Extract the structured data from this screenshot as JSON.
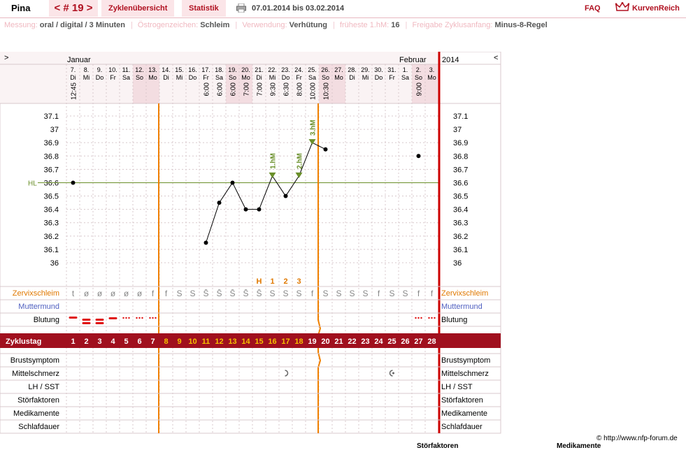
{
  "header": {
    "user": "Pina",
    "cycle_tab": "< # 19 >",
    "overview_tab": "Zyklenübersicht",
    "stats_tab": "Statistik",
    "range": "07.01.2014 bis 03.02.2014",
    "faq": "FAQ",
    "brand": "KurvenReich"
  },
  "info": {
    "measure_label": "Messung:",
    "measure_value": "oral / digital / 3 Minuten",
    "estrogen_label": "Östrogenzeichen:",
    "estrogen_value": "Schleim",
    "usage_label": "Verwendung:",
    "usage_value": "Verhütung",
    "earliest_label": "früheste 1.hM:",
    "earliest_value": "16",
    "release_label": "Freigabe Zyklusanfang:",
    "release_value": "Minus-8-Regel"
  },
  "nav": {
    "prev": ">",
    "next": "<",
    "year": "2014"
  },
  "chart_data": {
    "type": "line",
    "months": [
      {
        "label": "Januar",
        "day": 1
      },
      {
        "label": "Februar",
        "day": 26
      }
    ],
    "dates": [
      "7.",
      "8.",
      "9.",
      "10.",
      "11.",
      "12.",
      "13.",
      "14.",
      "15.",
      "16.",
      "17.",
      "18.",
      "19.",
      "20.",
      "21.",
      "22.",
      "23.",
      "24.",
      "25.",
      "26.",
      "27.",
      "28.",
      "29.",
      "30.",
      "31.",
      "1.",
      "2.",
      "3."
    ],
    "weekdays": [
      "Di",
      "Mi",
      "Do",
      "Fr",
      "Sa",
      "So",
      "Mo",
      "Di",
      "Mi",
      "Do",
      "Fr",
      "Sa",
      "So",
      "Mo",
      "Di",
      "Mi",
      "Do",
      "Fr",
      "Sa",
      "So",
      "Mo",
      "Di",
      "Mi",
      "Do",
      "Fr",
      "Sa",
      "So",
      "Mo"
    ],
    "weekend_days": [
      5,
      6,
      12,
      13,
      19,
      20,
      26,
      27
    ],
    "times": [
      "12:45",
      "",
      "",
      "",
      "",
      "",
      "",
      "",
      "",
      "",
      "6:00",
      "6:00",
      "6:00",
      "7:00",
      "7:00",
      "9:30",
      "6:30",
      "8:00",
      "10:00",
      "10:30",
      "",
      "",
      "",
      "",
      "",
      "",
      "9:00",
      ""
    ],
    "cycle_days": [
      1,
      2,
      3,
      4,
      5,
      6,
      7,
      8,
      9,
      10,
      11,
      12,
      13,
      14,
      15,
      16,
      17,
      18,
      19,
      20,
      21,
      22,
      23,
      24,
      25,
      26,
      27,
      28
    ],
    "x": [
      1,
      2,
      3,
      4,
      5,
      6,
      7,
      8,
      9,
      10,
      11,
      12,
      13,
      14,
      15,
      16,
      17,
      18,
      19,
      20,
      21,
      22,
      23,
      24,
      25,
      26,
      27,
      28
    ],
    "temperature": [
      36.6,
      null,
      null,
      null,
      null,
      null,
      null,
      null,
      null,
      null,
      36.15,
      36.45,
      36.6,
      36.4,
      36.4,
      36.65,
      36.5,
      36.65,
      36.9,
      36.85,
      null,
      null,
      null,
      null,
      null,
      null,
      36.8,
      null
    ],
    "y_ticks": [
      "37.1",
      "37",
      "36.9",
      "36.8",
      "36.7",
      "36.6",
      "36.5",
      "36.4",
      "36.3",
      "36.2",
      "36.1",
      "36"
    ],
    "ylim": [
      36,
      37.1
    ],
    "coverline": {
      "label": "HL",
      "value": 36.6
    },
    "annotations": [
      {
        "label": "1.hM",
        "day": 16
      },
      {
        "label": "2.hM",
        "day": 18
      },
      {
        "label": "3.hM",
        "day": 19
      }
    ],
    "peak_labels": [
      {
        "label": "H",
        "day": 15
      },
      {
        "label": "1",
        "day": 16
      },
      {
        "label": "2",
        "day": 17
      },
      {
        "label": "3",
        "day": 18
      }
    ],
    "mucus": [
      "t",
      "ø",
      "ø",
      "ø",
      "ø",
      "ø",
      "f",
      "f",
      "S",
      "S",
      "S̄",
      "S̄",
      "S̄",
      "S̄",
      "S̄",
      "S",
      "S",
      "S",
      "f",
      "S",
      "S",
      "S",
      "S",
      "f",
      "S",
      "S",
      "f",
      "f",
      "t"
    ],
    "bleeding": [
      "heavy",
      "strong",
      "strong",
      "medium",
      "light",
      "light",
      "light",
      "",
      "",
      "",
      "",
      "",
      "",
      "",
      "",
      "",
      "",
      "",
      "",
      "",
      "",
      "",
      "",
      "",
      "",
      "",
      "light",
      "light"
    ],
    "mittelschmerz": {
      "17": "right-icon",
      "25": "both-icon"
    },
    "rows": {
      "mucus": "Zervixschleim",
      "cervix": "Muttermund",
      "bleeding": "Blutung",
      "cycle": "Zyklustag",
      "breast": "Brustsymptom",
      "mittel": "Mittelschmerz",
      "lh": "LH / SST",
      "disturb": "Störfaktoren",
      "meds": "Medikamente",
      "sleep": "Schlafdauer"
    },
    "colors": {
      "line": "#000000",
      "coverline": "#6a8f2a",
      "rule": "#f08000",
      "cycle_bar": "#a0101e",
      "mucus": "#e07800",
      "cervix": "#5060c0",
      "blood": "#e01010",
      "cycle_num_late": "#f5c000",
      "end_line": "#cc0000"
    }
  },
  "footer": {
    "copyright": "© http://www.nfp-forum.de",
    "left": "Störfaktoren",
    "right": "Medikamente"
  }
}
